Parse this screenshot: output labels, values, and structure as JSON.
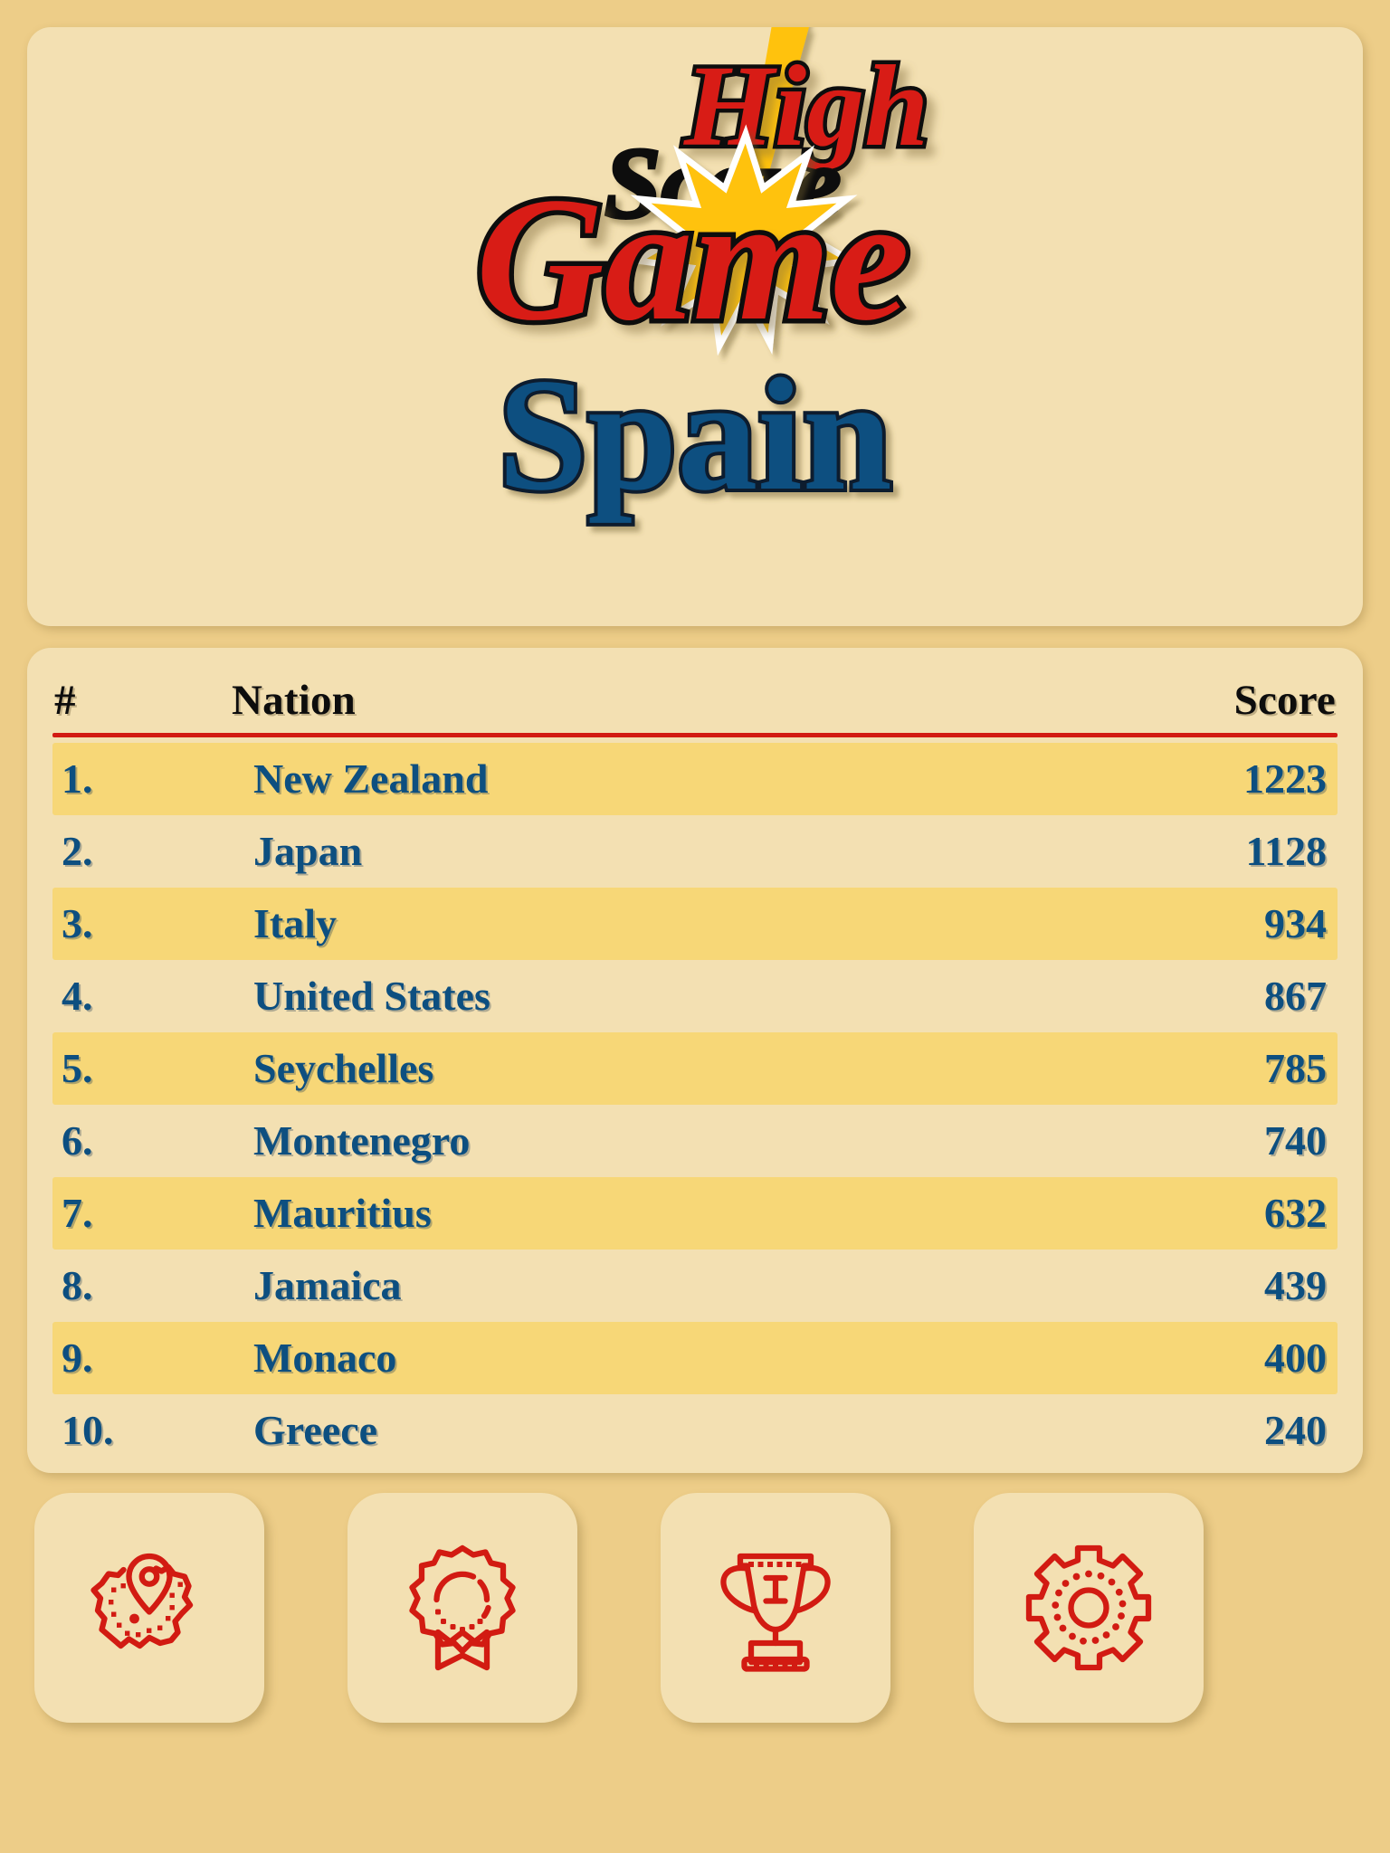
{
  "theme": {
    "page_bg": "#edcd88",
    "card_bg": "#f3e0b2",
    "row_alt_bg": "#f7d777",
    "accent_red": "#d21b12",
    "logo_red": "#d81f16",
    "logo_black": "#111111",
    "logo_yellow": "#ffc20e",
    "title_blue": "#0d4f80",
    "value_blue": "#0d4f80"
  },
  "logo": {
    "word_high": "High",
    "word_score": "Score",
    "word_game": "Game",
    "bolt_icon": "lightning-bolt-icon",
    "starburst_icon": "starburst-icon"
  },
  "header": {
    "title": "Spain"
  },
  "table": {
    "columns": {
      "rank": "#",
      "nation": "Nation",
      "score": "Score"
    },
    "rows": [
      {
        "rank": "1.",
        "nation": "New Zealand",
        "score": "1223"
      },
      {
        "rank": "2.",
        "nation": "Japan",
        "score": "1128"
      },
      {
        "rank": "3.",
        "nation": "Italy",
        "score": "934"
      },
      {
        "rank": "4.",
        "nation": "United States",
        "score": "867"
      },
      {
        "rank": "5.",
        "nation": "Seychelles",
        "score": "785"
      },
      {
        "rank": "6.",
        "nation": "Montenegro",
        "score": "740"
      },
      {
        "rank": "7.",
        "nation": "Mauritius",
        "score": "632"
      },
      {
        "rank": "8.",
        "nation": "Jamaica",
        "score": "439"
      },
      {
        "rank": "9.",
        "nation": "Monaco",
        "score": "400"
      },
      {
        "rank": "10.",
        "nation": "Greece",
        "score": "240"
      }
    ]
  },
  "chart_data": {
    "type": "table",
    "title": "High Score Game - Spain",
    "columns": [
      "#",
      "Nation",
      "Score"
    ],
    "categories": [
      "New Zealand",
      "Japan",
      "Italy",
      "United States",
      "Seychelles",
      "Montenegro",
      "Mauritius",
      "Jamaica",
      "Monaco",
      "Greece"
    ],
    "values": [
      1223,
      1128,
      934,
      867,
      785,
      740,
      632,
      439,
      400,
      240
    ],
    "ranks": [
      1,
      2,
      3,
      4,
      5,
      6,
      7,
      8,
      9,
      10
    ],
    "xlabel": "Nation",
    "ylabel": "Score",
    "ylim": [
      0,
      1223
    ],
    "legend": [],
    "grid": false
  },
  "tiles": [
    {
      "icon": "map-pin-icon",
      "label": "map"
    },
    {
      "icon": "award-ribbon-icon",
      "label": "award"
    },
    {
      "icon": "trophy-icon",
      "label": "trophy",
      "trophy_numeral": "I"
    },
    {
      "icon": "gear-icon",
      "label": "settings"
    }
  ]
}
